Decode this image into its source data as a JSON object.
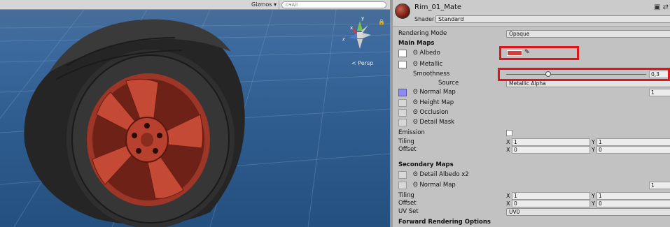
{
  "scene": {
    "gizmos_label": "Gizmos",
    "search_placeholder": "All",
    "persp_label": "< Persp",
    "axes": {
      "x": "x",
      "y": "y",
      "z": "z"
    }
  },
  "material": {
    "name": "Rim_01_Mate",
    "shader_label": "Shader",
    "shader_value": "Standard"
  },
  "inspector": {
    "rendering_mode_label": "Rendering Mode",
    "rendering_mode_value": "Opaque",
    "main_maps_header": "Main Maps",
    "albedo_label": "Albedo",
    "metallic_label": "Metallic",
    "smoothness_label": "Smoothness",
    "smoothness_value": "0,3",
    "smoothness_fraction": 0.3,
    "source_label": "Source",
    "source_value": "Metallic Alpha",
    "normal_map_label": "Normal Map",
    "normal_map_value": "1",
    "height_map_label": "Height Map",
    "occlusion_label": "Occlusion",
    "detail_mask_label": "Detail Mask",
    "emission_label": "Emission",
    "tiling_label": "Tiling",
    "offset_label": "Offset",
    "tiling_x": "1",
    "tiling_y": "1",
    "offset_x": "0",
    "offset_y": "0",
    "secondary_maps_header": "Secondary Maps",
    "detail_albedo_label": "Detail Albedo x2",
    "normal_map2_label": "Normal Map",
    "normal_map2_value": "1",
    "tiling2_x": "1",
    "tiling2_y": "1",
    "offset2_x": "0",
    "offset2_y": "0",
    "uv_set_label": "UV Set",
    "uv_set_value": "UV0",
    "forward_rendering_header": "Forward Rendering Options",
    "axis_x": "X",
    "axis_y": "Y"
  },
  "colors": {
    "albedo": "#d0413a",
    "highlight": "#e0151a",
    "rim": "#b8402e"
  }
}
